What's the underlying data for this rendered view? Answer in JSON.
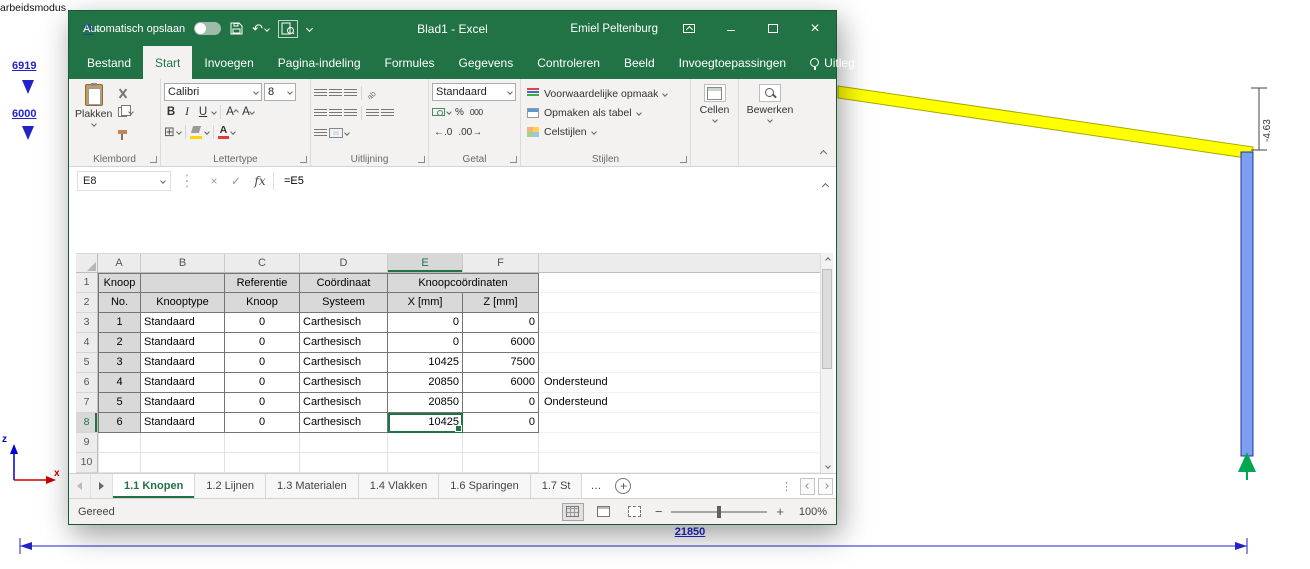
{
  "window": {
    "autosave_label": "Automatisch opslaan",
    "title": "Blad1 - Excel",
    "user": "Emiel Peltenburg"
  },
  "ribbon": {
    "tabs": [
      {
        "label": "Bestand"
      },
      {
        "label": "Start",
        "active": true
      },
      {
        "label": "Invoegen"
      },
      {
        "label": "Pagina-indeling"
      },
      {
        "label": "Formules"
      },
      {
        "label": "Gegevens"
      },
      {
        "label": "Controleren"
      },
      {
        "label": "Beeld"
      },
      {
        "label": "Invoegtoepassingen"
      },
      {
        "label": "Uitleg"
      }
    ],
    "clipboard": {
      "group_label": "Klembord",
      "paste_label": "Plakken"
    },
    "font": {
      "group_label": "Lettertype",
      "name": "Calibri",
      "size": "8",
      "bold": "B",
      "italic": "I",
      "underline": "U",
      "letter": "A"
    },
    "alignment": {
      "group_label": "Uitlijning"
    },
    "number": {
      "group_label": "Getal",
      "format": "Standaard",
      "percent": "%",
      "thousands": "000",
      "inc_decimal": "←.0",
      "dec_decimal": ".00→"
    },
    "styles": {
      "group_label": "Stijlen",
      "items": [
        {
          "label": "Voorwaardelijke opmaak"
        },
        {
          "label": "Opmaken als tabel"
        },
        {
          "label": "Celstijlen"
        }
      ]
    },
    "cells_label": "Cellen",
    "editing_label": "Bewerken"
  },
  "formula_bar": {
    "name_box": "E8",
    "fx": "fx",
    "formula": "=E5"
  },
  "grid": {
    "col_headers": [
      "A",
      "B",
      "C",
      "D",
      "E",
      "F"
    ],
    "selection": {
      "cell": "E8",
      "col": "E",
      "row": "8"
    },
    "rows": [
      {
        "n": "1",
        "kind": "hdr",
        "cells": [
          {
            "t": "Knoop"
          },
          {
            "t": ""
          },
          {
            "t": "Referentie"
          },
          {
            "t": "Coördinaat"
          },
          {
            "t": "Knoopcoördinaten",
            "span": 2
          }
        ]
      },
      {
        "n": "2",
        "kind": "hdr",
        "cells": [
          {
            "t": "No."
          },
          {
            "t": "Knooptype"
          },
          {
            "t": "Knoop"
          },
          {
            "t": "Systeem"
          },
          {
            "t": "X [mm]"
          },
          {
            "t": "Z [mm]"
          }
        ]
      },
      {
        "n": "3",
        "kind": "data",
        "cells": [
          {
            "t": "1",
            "hd": true
          },
          {
            "t": "Standaard",
            "al": "l"
          },
          {
            "t": "0"
          },
          {
            "t": "Carthesisch",
            "al": "l"
          },
          {
            "t": "0",
            "al": "r"
          },
          {
            "t": "0",
            "al": "r"
          }
        ]
      },
      {
        "n": "4",
        "kind": "data",
        "cells": [
          {
            "t": "2",
            "hd": true
          },
          {
            "t": "Standaard",
            "al": "l"
          },
          {
            "t": "0"
          },
          {
            "t": "Carthesisch",
            "al": "l"
          },
          {
            "t": "0",
            "al": "r"
          },
          {
            "t": "6000",
            "al": "r"
          }
        ]
      },
      {
        "n": "5",
        "kind": "data",
        "cells": [
          {
            "t": "3",
            "hd": true
          },
          {
            "t": "Standaard",
            "al": "l"
          },
          {
            "t": "0"
          },
          {
            "t": "Carthesisch",
            "al": "l"
          },
          {
            "t": "10425",
            "al": "r"
          },
          {
            "t": "7500",
            "al": "r"
          }
        ]
      },
      {
        "n": "6",
        "kind": "data",
        "note": "Ondersteund",
        "cells": [
          {
            "t": "4",
            "hd": true
          },
          {
            "t": "Standaard",
            "al": "l"
          },
          {
            "t": "0"
          },
          {
            "t": "Carthesisch",
            "al": "l"
          },
          {
            "t": "20850",
            "al": "r"
          },
          {
            "t": "6000",
            "al": "r"
          }
        ]
      },
      {
        "n": "7",
        "kind": "data",
        "note": "Ondersteund",
        "cells": [
          {
            "t": "5",
            "hd": true
          },
          {
            "t": "Standaard",
            "al": "l"
          },
          {
            "t": "0"
          },
          {
            "t": "Carthesisch",
            "al": "l"
          },
          {
            "t": "20850",
            "al": "r"
          },
          {
            "t": "0",
            "al": "r"
          }
        ]
      },
      {
        "n": "8",
        "kind": "data",
        "cells": [
          {
            "t": "6",
            "hd": true
          },
          {
            "t": "Standaard",
            "al": "l"
          },
          {
            "t": "0"
          },
          {
            "t": "Carthesisch",
            "al": "l"
          },
          {
            "t": "10425",
            "al": "r",
            "sel": true
          },
          {
            "t": "0",
            "al": "r"
          }
        ]
      },
      {
        "n": "9",
        "kind": "empty"
      },
      {
        "n": "10",
        "kind": "empty"
      }
    ]
  },
  "sheet_tabs": {
    "tabs": [
      {
        "label": "1.1 Knopen",
        "active": true
      },
      {
        "label": "1.2 Lijnen"
      },
      {
        "label": "1.3 Materialen"
      },
      {
        "label": "1.4 Vlakken"
      },
      {
        "label": "1.6 Sparingen"
      },
      {
        "label": "1.7 St"
      }
    ],
    "overflow": "…"
  },
  "status_bar": {
    "ready": "Gereed",
    "zoom": "100%"
  },
  "drawing": {
    "mode_text": "arbeidsmodus",
    "dim_left_top": "6919",
    "dim_left_bottom": "6000",
    "dim_height": "-4.63",
    "dim_span": "21850",
    "axis_vertical": "z",
    "axis_horizontal": "x"
  },
  "colors": {
    "excel_green": "#217346",
    "beam_fill": "#ffff00",
    "beam_stroke": "#a8a800",
    "column_fill": "#7d9ff1",
    "column_stroke": "#2133a0",
    "support_green": "#00a651",
    "dimension_blue": "#2323c8"
  }
}
